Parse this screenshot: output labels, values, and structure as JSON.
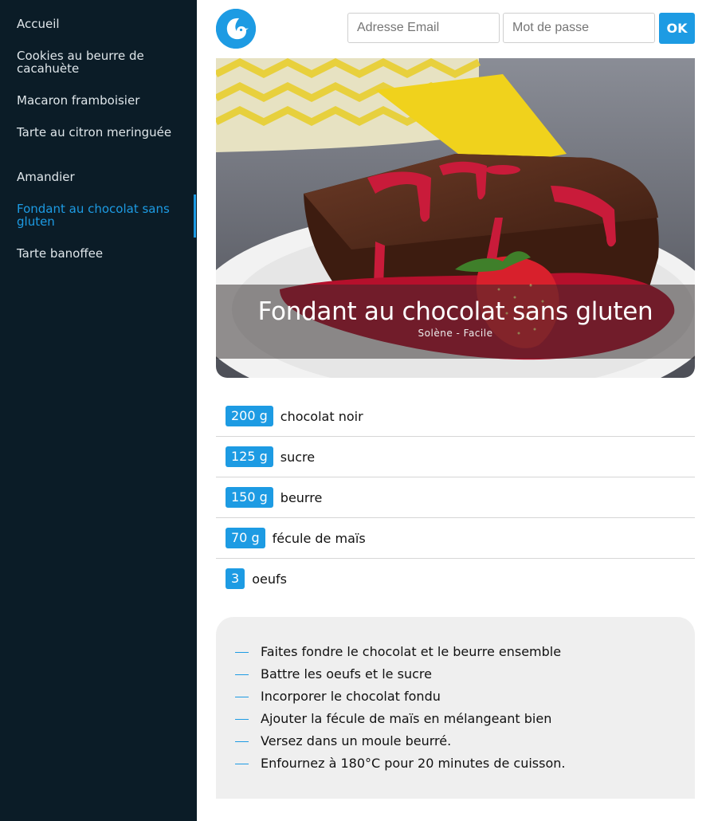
{
  "sidebar": {
    "items": [
      {
        "label": "Accueil",
        "active": false
      },
      {
        "label": "Cookies au beurre de cacahuète",
        "active": false
      },
      {
        "label": "Macaron framboisier",
        "active": false
      },
      {
        "label": "Tarte au citron meringuée",
        "active": false
      },
      {
        "label": "Amandier",
        "active": false
      },
      {
        "label": "Fondant au chocolat sans gluten",
        "active": true
      },
      {
        "label": "Tarte banoffee",
        "active": false
      }
    ]
  },
  "header": {
    "logo_icon": "bird-logo-icon",
    "email_placeholder": "Adresse Email",
    "password_placeholder": "Mot de passe",
    "submit_label": "OK"
  },
  "recipe": {
    "title": "Fondant au chocolat sans gluten",
    "meta": "Solène - Facile",
    "image": "chocolate-cake-with-strawberry-image",
    "ingredients": [
      {
        "quantity": "200 g",
        "name": "chocolat noir"
      },
      {
        "quantity": "125 g",
        "name": "sucre"
      },
      {
        "quantity": "150 g",
        "name": "beurre"
      },
      {
        "quantity": "70 g",
        "name": "fécule de maïs"
      },
      {
        "quantity": "3",
        "name": "oeufs"
      }
    ],
    "steps": [
      "Faites fondre le chocolat et le beurre ensemble",
      "Battre les oeufs et le sucre",
      "Incorporer le chocolat fondu",
      "Ajouter la fécule de maïs en mélangeant bien",
      "Versez dans un moule beurré.",
      "Enfournez à 180°C pour 20 minutes de cuisson."
    ]
  },
  "colors": {
    "accent": "#1d9be3",
    "sidebar_bg": "#0b1c27",
    "steps_bg": "#efefef"
  }
}
